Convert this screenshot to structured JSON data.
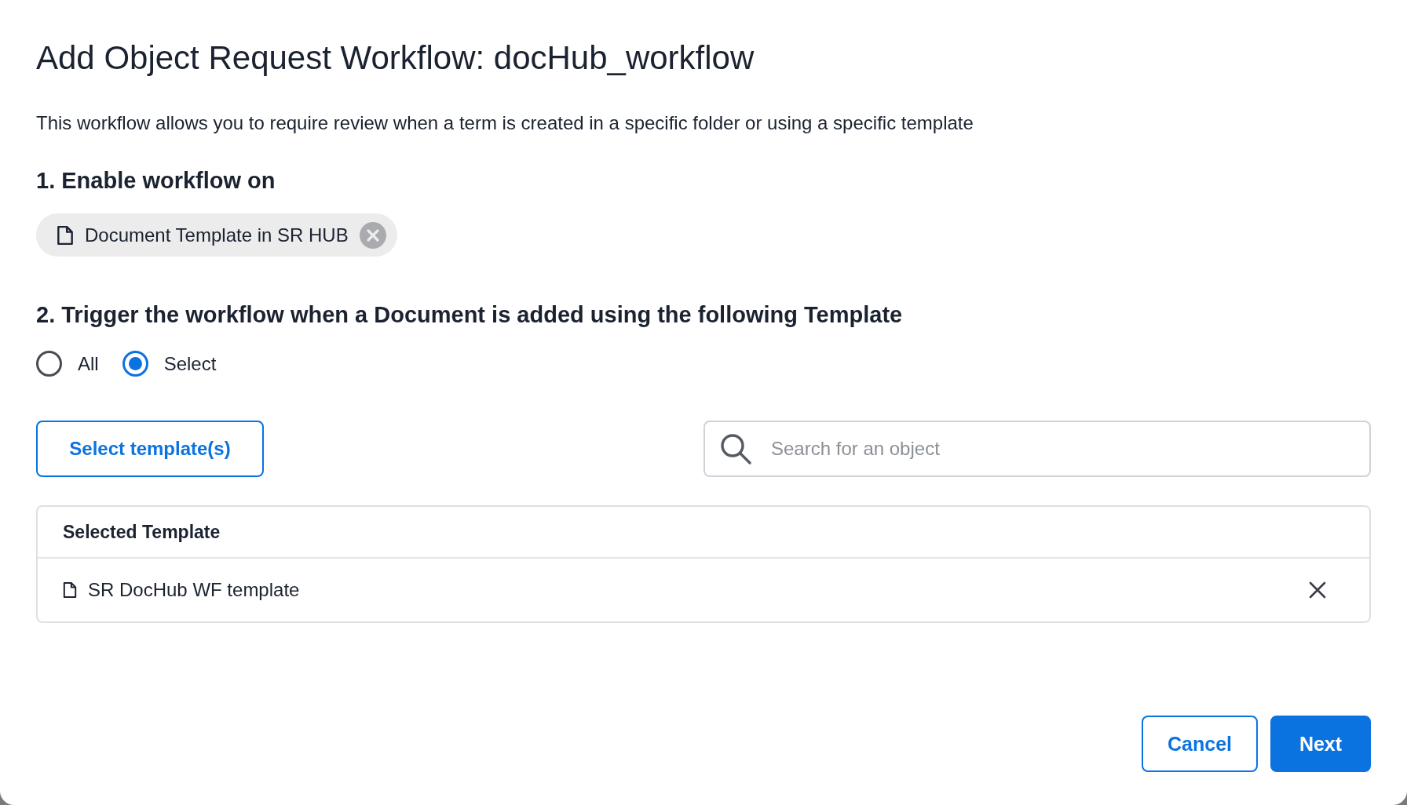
{
  "dialog": {
    "title": "Add Object Request Workflow: docHub_workflow",
    "description": "This workflow allows you to require review when a term is created in a specific folder or using a specific template"
  },
  "step1": {
    "heading": "1. Enable workflow on",
    "chip": {
      "label": "Document Template in SR HUB"
    }
  },
  "step2": {
    "heading": "2. Trigger the workflow when a Document is added using the following Template",
    "options": [
      {
        "label": "All",
        "selected": false
      },
      {
        "label": "Select",
        "selected": true
      }
    ]
  },
  "select_button": "Select template(s)",
  "search": {
    "placeholder": "Search for an object"
  },
  "table": {
    "header": "Selected Template",
    "rows": [
      {
        "label": "SR DocHub WF template"
      }
    ]
  },
  "buttons": [
    {
      "label": "Cancel",
      "kind": "secondary"
    },
    {
      "label": "Next",
      "kind": "primary"
    }
  ]
}
